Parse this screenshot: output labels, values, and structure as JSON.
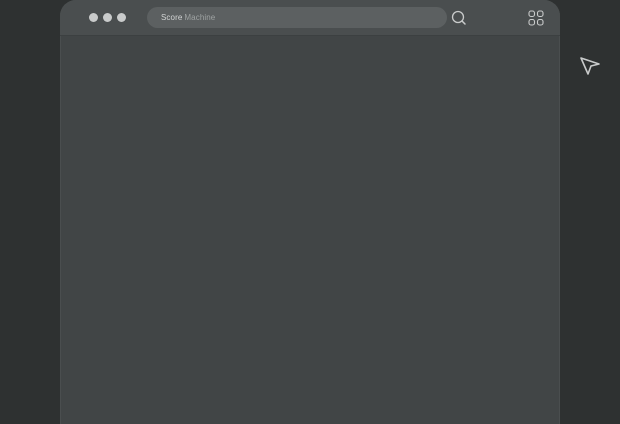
{
  "window": {
    "title_brand": "Score",
    "title_product": "Machine"
  },
  "icons": {
    "traffic_lights": [
      "window-dot-icon",
      "window-dot-icon",
      "window-dot-icon"
    ],
    "search": "search-icon",
    "apps": "apps-grid-icon",
    "cursor": "arrow-cursor-icon"
  },
  "colors": {
    "desktop": "#2e3131",
    "window": "#414546",
    "titlebar": "#4a4e4f",
    "address_bar": "#5c6061"
  }
}
